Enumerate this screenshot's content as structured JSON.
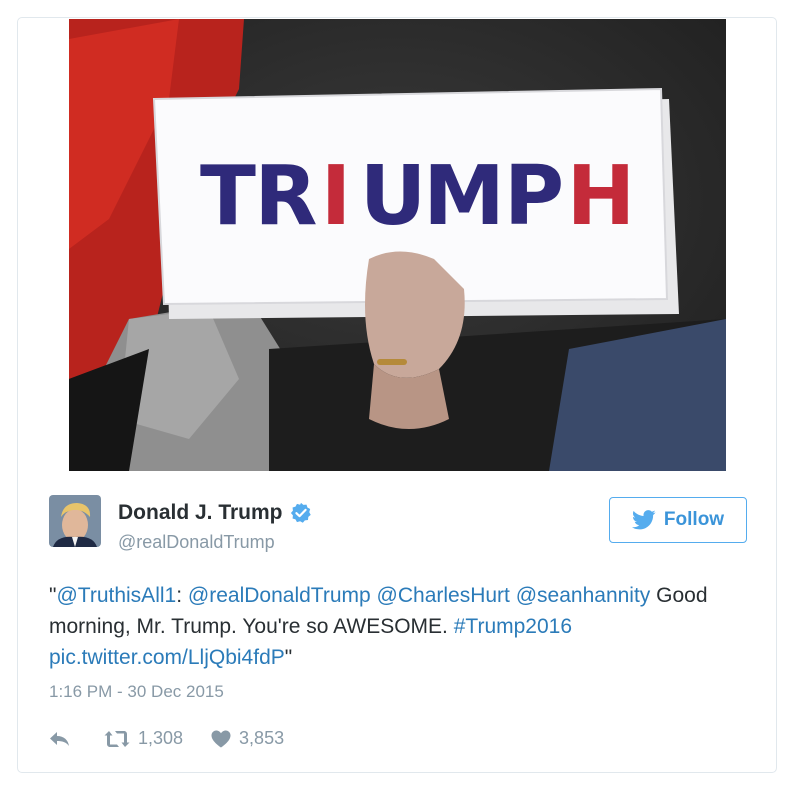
{
  "media": {
    "sign_letters": [
      {
        "char": "T",
        "color": "#2f2a7a"
      },
      {
        "char": "R",
        "color": "#2f2a7a"
      },
      {
        "char": "I",
        "color": "#c42b3a"
      },
      {
        "char": "U",
        "color": "#2f2a7a"
      },
      {
        "char": "M",
        "color": "#2f2a7a"
      },
      {
        "char": "P",
        "color": "#2f2a7a"
      },
      {
        "char": "H",
        "color": "#c42b3a"
      }
    ]
  },
  "user": {
    "name": "Donald J. Trump",
    "handle": "@realDonaldTrump",
    "verified": true
  },
  "follow_button": {
    "label": "Follow",
    "color": "#55acee"
  },
  "tweet": {
    "open_quote": "\"",
    "mention1": "@TruthisAll1",
    "colon": ":",
    "mention2": "@realDonaldTrump",
    "mention3": "@CharlesHurt",
    "mention4": "@seanhannity",
    "body": "Good morning, Mr. Trump. You're so AWESOME.",
    "hashtag": "#Trump2016",
    "pic_link": "pic.twitter.com/LljQbi4fdP",
    "close_quote": "\""
  },
  "timestamp": "1:16 PM - 30 Dec 2015",
  "actions": {
    "retweets": "1,308",
    "likes": "3,853"
  },
  "colors": {
    "link": "#2b7bb9",
    "muted": "#8899a6",
    "text": "#292f33"
  }
}
